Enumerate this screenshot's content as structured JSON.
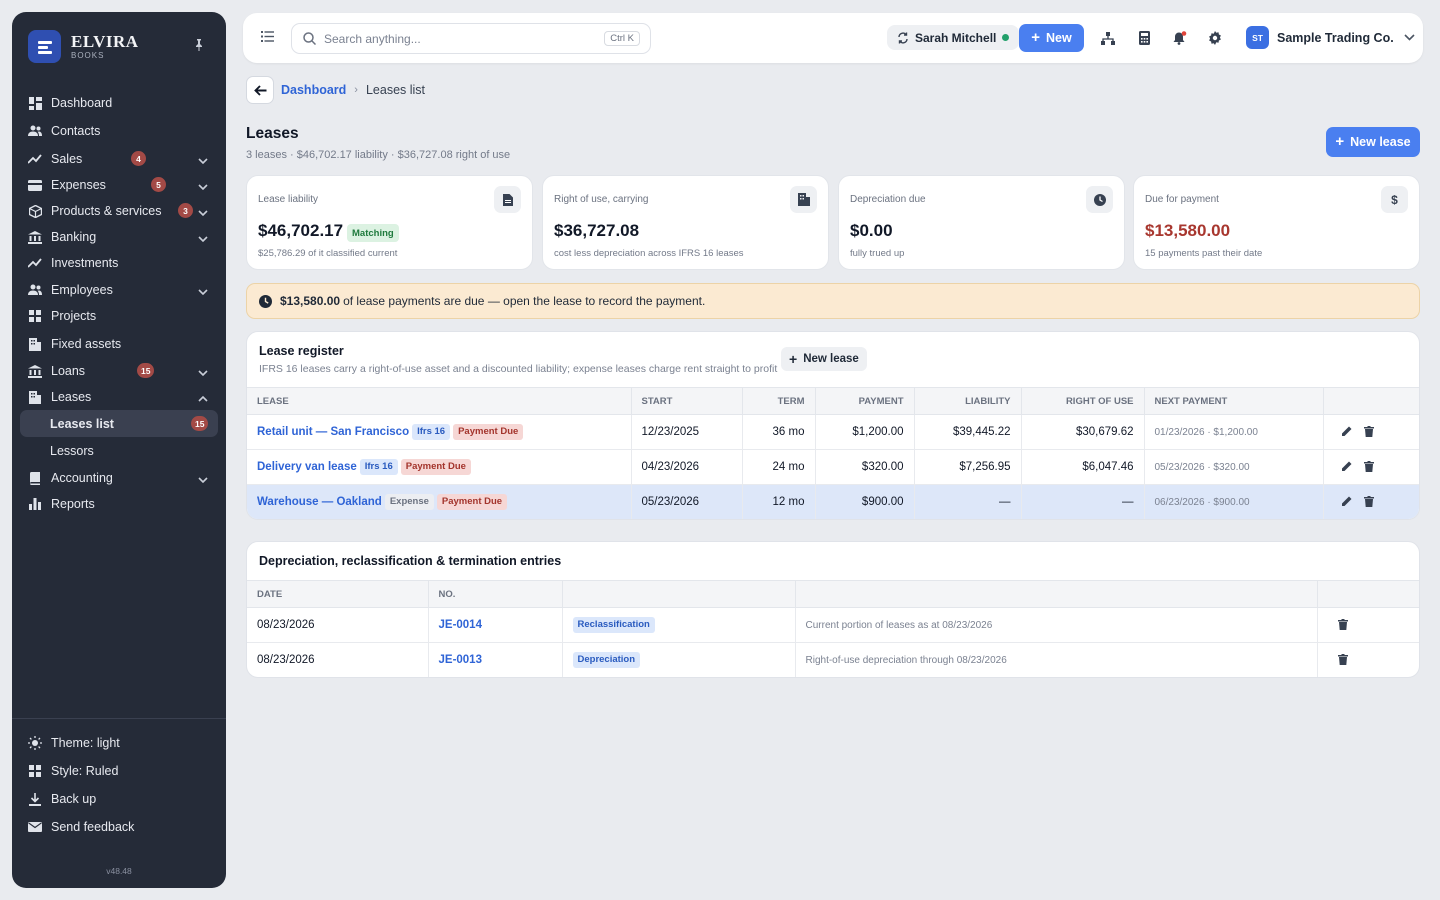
{
  "brand": {
    "name": "ELVIRA",
    "sub": "BOOKS"
  },
  "sidebar": {
    "items": [
      {
        "label": "Dashboard"
      },
      {
        "label": "Contacts"
      },
      {
        "label": "Sales",
        "badge": "4"
      },
      {
        "label": "Expenses",
        "badge": "5"
      },
      {
        "label": "Products & services",
        "badge": "3"
      },
      {
        "label": "Banking"
      },
      {
        "label": "Investments"
      },
      {
        "label": "Employees"
      },
      {
        "label": "Projects"
      },
      {
        "label": "Fixed assets"
      },
      {
        "label": "Loans",
        "badge": "15"
      },
      {
        "label": "Leases"
      },
      {
        "label": "Leases list",
        "badge": "15"
      },
      {
        "label": "Lessors"
      },
      {
        "label": "Accounting"
      },
      {
        "label": "Reports"
      }
    ],
    "footer": [
      {
        "label": "Theme: light"
      },
      {
        "label": "Style: Ruled"
      },
      {
        "label": "Back up"
      },
      {
        "label": "Send feedback"
      }
    ],
    "version": "v48.48"
  },
  "topbar": {
    "search_placeholder": "Search anything...",
    "search_shortcut": "Ctrl K",
    "user": "Sarah Mitchell",
    "new_label": "New",
    "org_initials": "ST",
    "org_name": "Sample Trading Co."
  },
  "breadcrumb": {
    "parent": "Dashboard",
    "current": "Leases list"
  },
  "page": {
    "title": "Leases",
    "subtitle": "3 leases · $46,702.17 liability · $36,727.08 right of use",
    "new_lease_label": "New lease"
  },
  "kpis": [
    {
      "label": "Lease liability",
      "value": "$46,702.17",
      "tag": "Matching",
      "foot": "$25,786.29 of it classified current",
      "icon": "document-icon"
    },
    {
      "label": "Right of use, carrying",
      "value": "$36,727.08",
      "foot": "cost less depreciation across IFRS 16 leases",
      "icon": "building-icon"
    },
    {
      "label": "Depreciation due",
      "value": "$0.00",
      "foot": "fully trued up",
      "icon": "clock-icon"
    },
    {
      "label": "Due for payment",
      "value": "$13,580.00",
      "foot": "15 payments past their date",
      "icon": "dollar-icon",
      "color": "#a8372f"
    }
  ],
  "alert": {
    "amount": "$13,580.00",
    "text": "of lease payments are due — open the lease to record the payment."
  },
  "register": {
    "title": "Lease register",
    "description": "IFRS 16 leases carry a right-of-use asset and a discounted liability; expense leases charge rent straight to profit",
    "new_label": "New lease",
    "columns": [
      "Lease",
      "Start",
      "Term",
      "Payment",
      "Liability",
      "Right of use",
      "Next payment"
    ],
    "rows": [
      {
        "name": "Retail unit — San Francisco",
        "type": "Ifrs 16",
        "status": "Payment Due",
        "start": "12/23/2025",
        "term": "36 mo",
        "payment": "$1,200.00",
        "liability": "$39,445.22",
        "rou": "$30,679.62",
        "next": "01/23/2026 · $1,200.00"
      },
      {
        "name": "Delivery van lease",
        "type": "Ifrs 16",
        "status": "Payment Due",
        "start": "04/23/2026",
        "term": "24 mo",
        "payment": "$320.00",
        "liability": "$7,256.95",
        "rou": "$6,047.46",
        "next": "05/23/2026 · $320.00"
      },
      {
        "name": "Warehouse — Oakland",
        "type": "Expense",
        "status": "Payment Due",
        "start": "05/23/2026",
        "term": "12 mo",
        "payment": "$900.00",
        "liability": "—",
        "rou": "—",
        "next": "06/23/2026 · $900.00"
      }
    ]
  },
  "entries": {
    "title": "Depreciation, reclassification & termination entries",
    "columns": [
      "Date",
      "No."
    ],
    "rows": [
      {
        "date": "08/23/2026",
        "no": "JE-0014",
        "kind": "Reclassification",
        "memo": "Current portion of leases as at 08/23/2026"
      },
      {
        "date": "08/23/2026",
        "no": "JE-0013",
        "kind": "Depreciation",
        "memo": "Right-of-use depreciation through 08/23/2026"
      }
    ]
  }
}
